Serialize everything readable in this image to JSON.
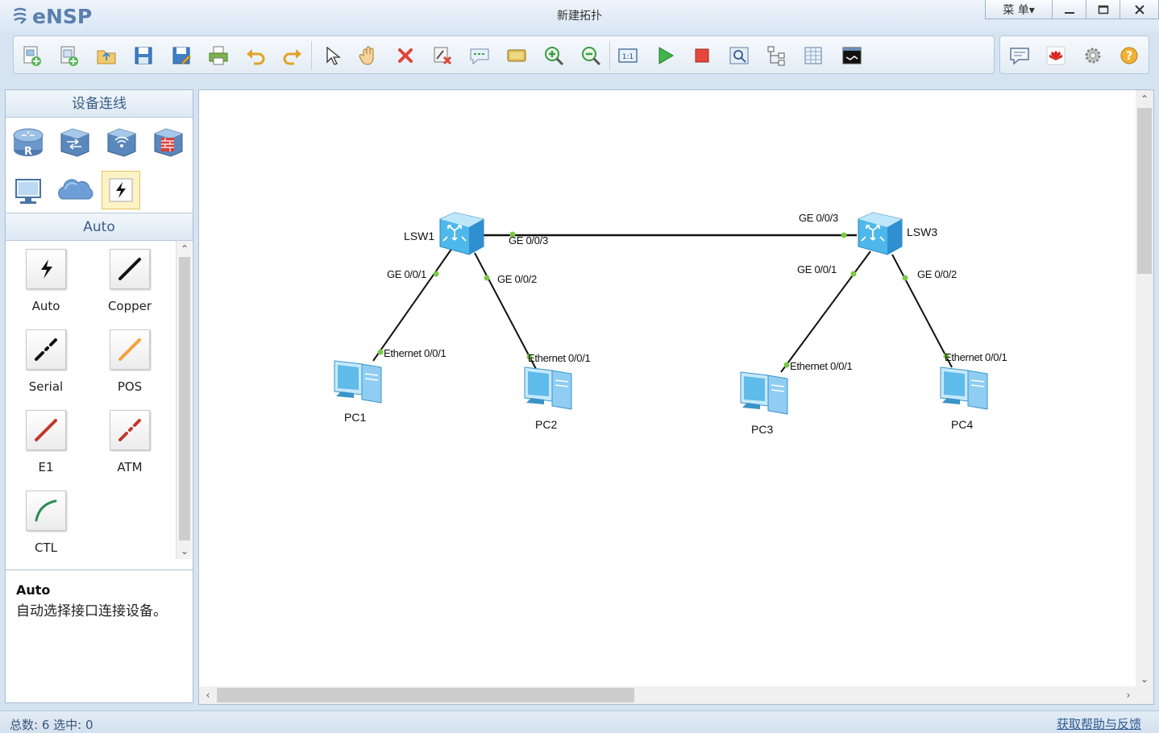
{
  "app": {
    "name": "eNSP",
    "window_title": "新建拓扑",
    "menu_label": "菜 单▾"
  },
  "toolbar": {
    "icons": [
      "new-topology-icon",
      "new-example-icon",
      "open-icon",
      "save-icon",
      "save-as-icon",
      "print-icon",
      "undo-icon",
      "redo-icon",
      "select-icon",
      "hand-icon",
      "delete-icon",
      "delete-link-icon",
      "text-icon",
      "palette-icon",
      "zoom-in-icon",
      "zoom-out-icon",
      "restore-icon",
      "start-device-icon",
      "stop-device-icon",
      "capture-icon",
      "topology-icon",
      "grid-icon",
      "terminal-icon"
    ],
    "right_icons": [
      "chat-icon",
      "huawei-icon",
      "settings-icon",
      "help-icon"
    ]
  },
  "left_panel": {
    "devices_header": "设备连线",
    "device_icons": [
      "router-icon",
      "switch-icon",
      "wlan-icon",
      "firewall-icon",
      "pc-icon",
      "cloud-icon",
      "connection-icon"
    ],
    "cables_header": "Auto",
    "cables": [
      {
        "label": "Auto",
        "color": "#111111"
      },
      {
        "label": "Copper",
        "color": "#111111"
      },
      {
        "label": "Serial",
        "color": "#111111"
      },
      {
        "label": "POS",
        "color": "#f5a03a"
      },
      {
        "label": "E1",
        "color": "#c0392b"
      },
      {
        "label": "ATM",
        "color": "#c0392b"
      },
      {
        "label": "CTL",
        "color": "#2e8b57"
      }
    ],
    "description": {
      "title": "Auto",
      "text": "自动选择接口连接设备。"
    }
  },
  "topology": {
    "nodes": [
      {
        "id": "LSW1",
        "label": "LSW1",
        "type": "switch"
      },
      {
        "id": "LSW3",
        "label": "LSW3",
        "type": "switch"
      },
      {
        "id": "PC1",
        "label": "PC1",
        "type": "pc"
      },
      {
        "id": "PC2",
        "label": "PC2",
        "type": "pc"
      },
      {
        "id": "PC3",
        "label": "PC3",
        "type": "pc"
      },
      {
        "id": "PC4",
        "label": "PC4",
        "type": "pc"
      }
    ],
    "links": [
      {
        "from": "LSW1",
        "from_port": "GE 0/0/3",
        "to": "LSW3",
        "to_port": "GE 0/0/3"
      },
      {
        "from": "LSW1",
        "from_port": "GE 0/0/1",
        "to": "PC1",
        "to_port": "Ethernet 0/0/1"
      },
      {
        "from": "LSW1",
        "from_port": "GE 0/0/2",
        "to": "PC2",
        "to_port": "Ethernet 0/0/1"
      },
      {
        "from": "LSW3",
        "from_port": "GE 0/0/1",
        "to": "PC3",
        "to_port": "Ethernet 0/0/1"
      },
      {
        "from": "LSW3",
        "from_port": "GE 0/0/2",
        "to": "PC4",
        "to_port": "Ethernet 0/0/1"
      }
    ],
    "port_dot_color": "#7ac943"
  },
  "status": {
    "counts": "总数: 6 选中: 0",
    "help_link": "获取帮助与反馈"
  }
}
